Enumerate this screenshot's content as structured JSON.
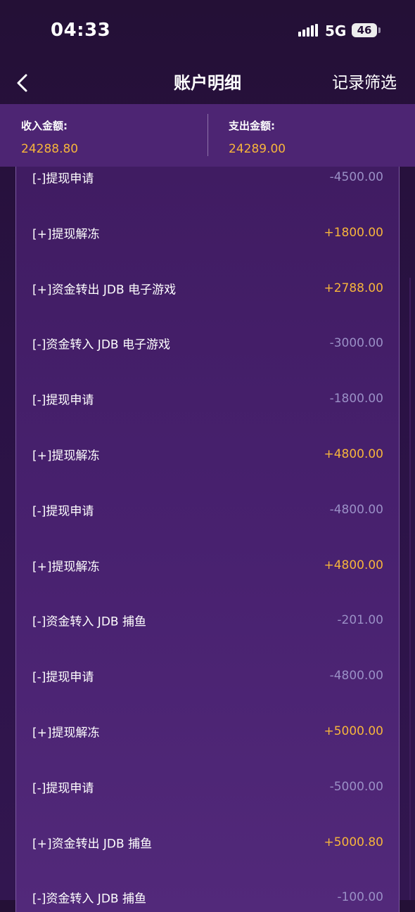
{
  "status_bar": {
    "time": "04:33",
    "network": "5G",
    "battery": "46",
    "icons": [
      "signal-icon",
      "battery-icon"
    ]
  },
  "nav": {
    "back_icon": "chevron-left-icon",
    "title": "账户明细",
    "filter_label": "记录筛选"
  },
  "summary": {
    "income_label": "收入金额:",
    "income_value": "24288.80",
    "expense_label": "支出金额:",
    "expense_value": "24289.00"
  },
  "colors": {
    "income": "#f7b53b",
    "expense": "#9a90c6",
    "background": "#2a1244",
    "summary_bg": "#4d2573"
  },
  "records": [
    {
      "desc": "[-]提现申请",
      "amount": "-4500.00",
      "type": "out"
    },
    {
      "desc": "[+]提现解冻",
      "amount": "+1800.00",
      "type": "in"
    },
    {
      "desc": "[+]资金转出 JDB 电子游戏",
      "amount": "+2788.00",
      "type": "in"
    },
    {
      "desc": "[-]资金转入 JDB 电子游戏",
      "amount": "-3000.00",
      "type": "out"
    },
    {
      "desc": "[-]提现申请",
      "amount": "-1800.00",
      "type": "out"
    },
    {
      "desc": "[+]提现解冻",
      "amount": "+4800.00",
      "type": "in"
    },
    {
      "desc": "[-]提现申请",
      "amount": "-4800.00",
      "type": "out"
    },
    {
      "desc": "[+]提现解冻",
      "amount": "+4800.00",
      "type": "in"
    },
    {
      "desc": "[-]资金转入 JDB 捕鱼",
      "amount": "-201.00",
      "type": "out"
    },
    {
      "desc": "[-]提现申请",
      "amount": "-4800.00",
      "type": "out"
    },
    {
      "desc": "[+]提现解冻",
      "amount": "+5000.00",
      "type": "in"
    },
    {
      "desc": "[-]提现申请",
      "amount": "-5000.00",
      "type": "out"
    },
    {
      "desc": "[+]资金转出 JDB 捕鱼",
      "amount": "+5000.80",
      "type": "in"
    },
    {
      "desc": "[-]资金转入 JDB 捕鱼",
      "amount": "-100.00",
      "type": "out"
    }
  ]
}
